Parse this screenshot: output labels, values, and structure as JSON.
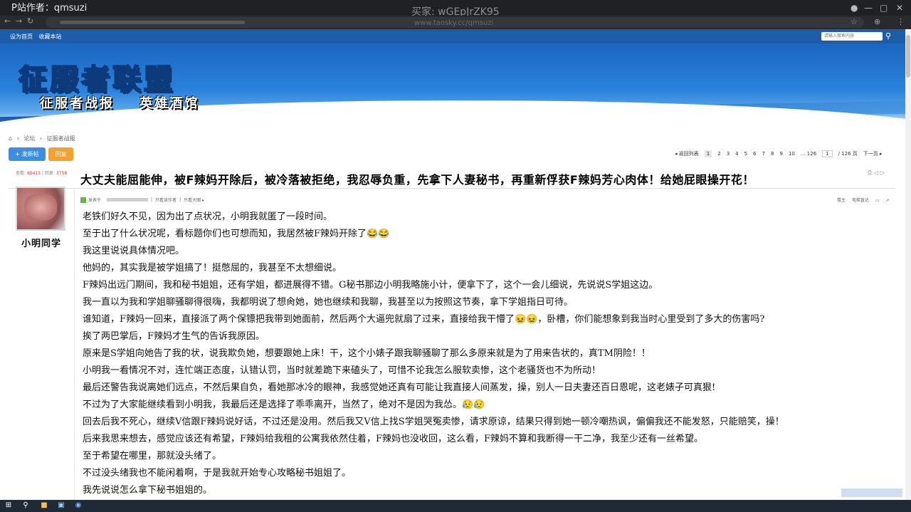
{
  "browser": {
    "tab_title": "P站作者：qmsuzi",
    "watermark_line1": "买家: wGEpJrZK95",
    "watermark_line2": "www.taosky.cc/qmsuzi"
  },
  "site": {
    "top_links": [
      "设为首页",
      "收藏本站"
    ],
    "search_placeholder": "请输入搜索内容",
    "banner_title": "征服者联盟",
    "banner_sub": [
      "征服者战报",
      "英雄酒馆"
    ]
  },
  "breadcrumb": [
    "论坛",
    "征服者战报"
  ],
  "actions": {
    "post": "+ 发新帖",
    "reply": "回复"
  },
  "pager": {
    "back": "◂ 返回列表",
    "pages": [
      "1",
      "2",
      "3",
      "4",
      "5",
      "6",
      "7",
      "8",
      "9",
      "10",
      "... 126"
    ],
    "input": "1",
    "total": "/ 126 页",
    "next": "下一页 ▸"
  },
  "stats": {
    "views_label": "查看:",
    "views": "60415",
    "replies_label": "回复:",
    "replies": "3758"
  },
  "thread_title": "大丈夫能屈能伸，被F辣妈开除后，被冷落被拒绝，我忍辱负重，先拿下人妻秘书，再重新俘获F辣妈芳心肉体！给她屁眼操开花！",
  "author": {
    "name": "小明同学"
  },
  "post_meta": {
    "posted_label": "发表于",
    "author_only": "只看该作者",
    "big_pic": "只看大图 ▸"
  },
  "post_tools": [
    "楼主",
    "电梯直达"
  ],
  "paragraphs": [
    "老铁们好久不见，因为出了点状况，小明我就匿了一段时间。",
    "至于出了什么状况呢，看标题你们也可想而知，我居然被F辣妈开除了😂😂",
    "我这里说说具体情况吧。",
    "他妈的，其实我是被学姐搞了！挺憋屈的，我甚至不太想细说。",
    "F辣妈出远门期间，我和秘书姐姐，还有学姐，都进展得不错。G秘书那边小明我略施小计，便拿下了，这个一会儿细说，先说说S学姐这边。",
    "我一直以为我和学姐聊骚聊得很嗨，我都明说了想肏她，她也继续和我聊，我甚至以为按照这节奏，拿下学姐指日可待。",
    "谁知道，F辣妈一回来，直接派了两个保镖把我带到她面前，然后两个大逼兜就扇了过来，直接给我干懵了😖😖，卧槽，你们能想象到我当时心里受到了多大的伤害吗?",
    "挨了两巴掌后，F辣妈才生气的告诉我原因。",
    "原来是S学姐向她告了我的状，说我欺负她，想要跟她上床！干，这个小婊子跟我聊骚聊了那么多原来就是为了用来告状的，真TM阴险！！",
    "小明我一看情况不对，连忙端正态度，认错认罚，当时就差跪下来磕头了，可惜不论我怎么服软卖惨，这个老骚货也不为所动！",
    "最后还警告我说离她们远点，不然后果自负，看她那冰冷的眼神，我感觉她还真有可能让我直接人间蒸发，操，别人一日夫妻还百日恩呢，这老婊子可真狠!",
    "不过为了大家能继续看到小明我，我最后还是选择了乖乖离开，当然了，绝对不是因为我怂。😥😥",
    "回去后我不死心，继续V信跟F辣妈说好话，不过还是没用。然后我又V信上找S学姐哭冤卖惨，请求原谅，结果只得到她一顿冷嘲热讽，偏偏我还不能发怒，只能赔笑，操！",
    "后来我思来想去，感觉应该还有希望，F辣妈给我租的公寓我依然住着，F辣妈也没收回，这么看，F辣妈不算和我断得一干二净，我至少还有一丝希望。",
    "至于希望在哪里，那就没头绪了。",
    "不过没头绪我也不能闲着啊，于是我就开始专心攻略秘书姐姐了。",
    "我先说说怎么拿下秘书姐姐的。"
  ]
}
